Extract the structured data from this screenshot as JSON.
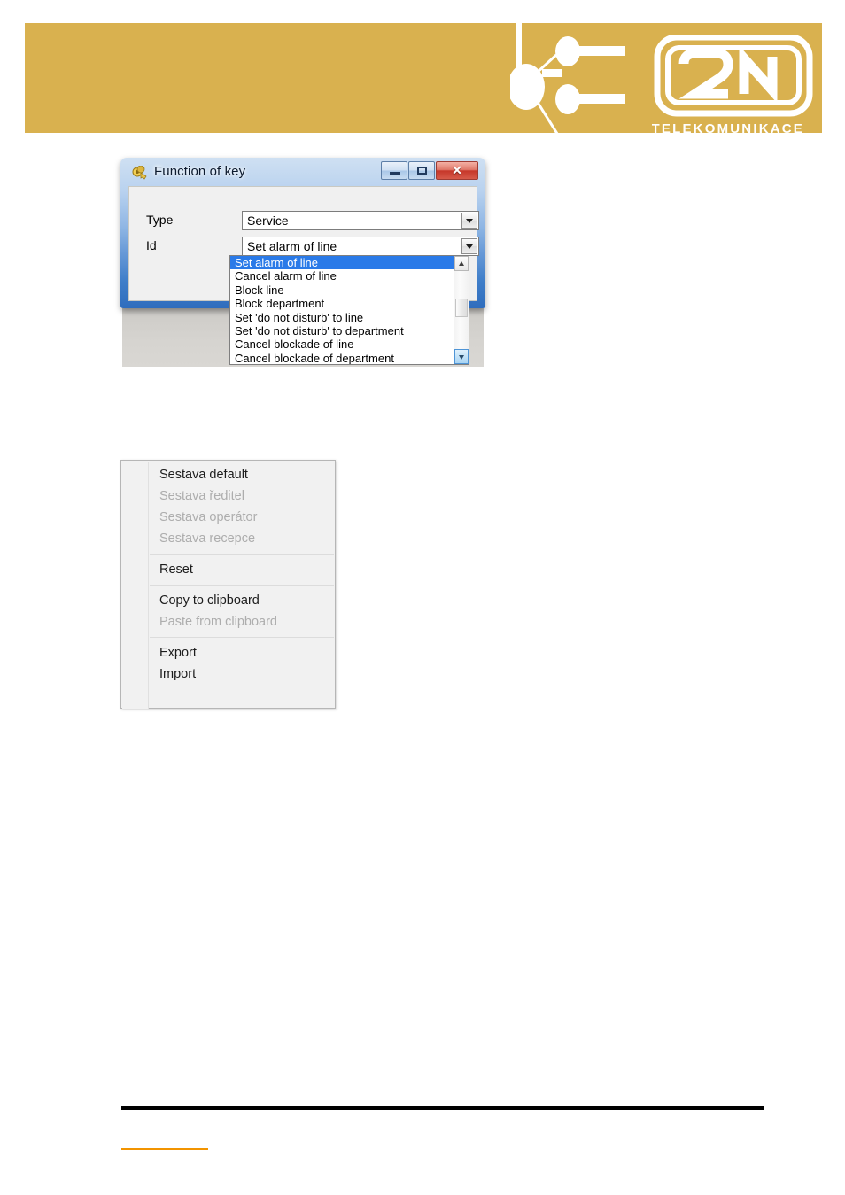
{
  "header": {
    "brand": "2N",
    "brand_subtitle": "TELEKOMUNIKACE",
    "band_color": "#d9b14f",
    "logo_icon": "network-nodes-icon"
  },
  "dialog": {
    "title": "Function of key",
    "icon": "keys-icon",
    "window_buttons": [
      {
        "name": "minimize-button",
        "glyph": "minimize-icon",
        "label": ""
      },
      {
        "name": "restore-button",
        "glyph": "restore-icon",
        "label": ""
      },
      {
        "name": "close-button",
        "glyph": "close-icon",
        "label": "✕"
      }
    ],
    "fields": [
      {
        "label": "Type",
        "value": "Service",
        "name": "type"
      },
      {
        "label": "Id",
        "value": "Set alarm of line",
        "name": "id"
      }
    ],
    "ok_button": {
      "label": "",
      "icon": "green-check-icon"
    }
  },
  "dropdown": {
    "selected_index": 0,
    "items": [
      "Set alarm of line",
      "Cancel alarm of line",
      "Block line",
      "Block department",
      "Set 'do not disturb' to line",
      "Set 'do not disturb' to department",
      "Cancel blockade of line",
      "Cancel blockade of department"
    ],
    "scrollbar": {
      "up_icon": "scroll-up-icon",
      "down_icon": "scroll-down-icon"
    },
    "highlight_color": "#2a7ae8"
  },
  "context_menu": {
    "items": [
      {
        "label": "Sestava default",
        "enabled": true
      },
      {
        "label": "Sestava ředitel",
        "enabled": false
      },
      {
        "label": "Sestava operátor",
        "enabled": false
      },
      {
        "label": "Sestava recepce",
        "enabled": false
      },
      {
        "separator_after": true
      },
      {
        "label": "Reset",
        "enabled": true
      },
      {
        "separator_after": true
      },
      {
        "label": "Copy to clipboard",
        "enabled": true
      },
      {
        "label": "Paste from clipboard",
        "enabled": false
      },
      {
        "separator_after": true
      },
      {
        "label": "Export",
        "enabled": true
      },
      {
        "label": "Import",
        "enabled": true
      }
    ]
  },
  "footer": {
    "rule_color": "#000000",
    "link_rule_color": "#f29400"
  }
}
